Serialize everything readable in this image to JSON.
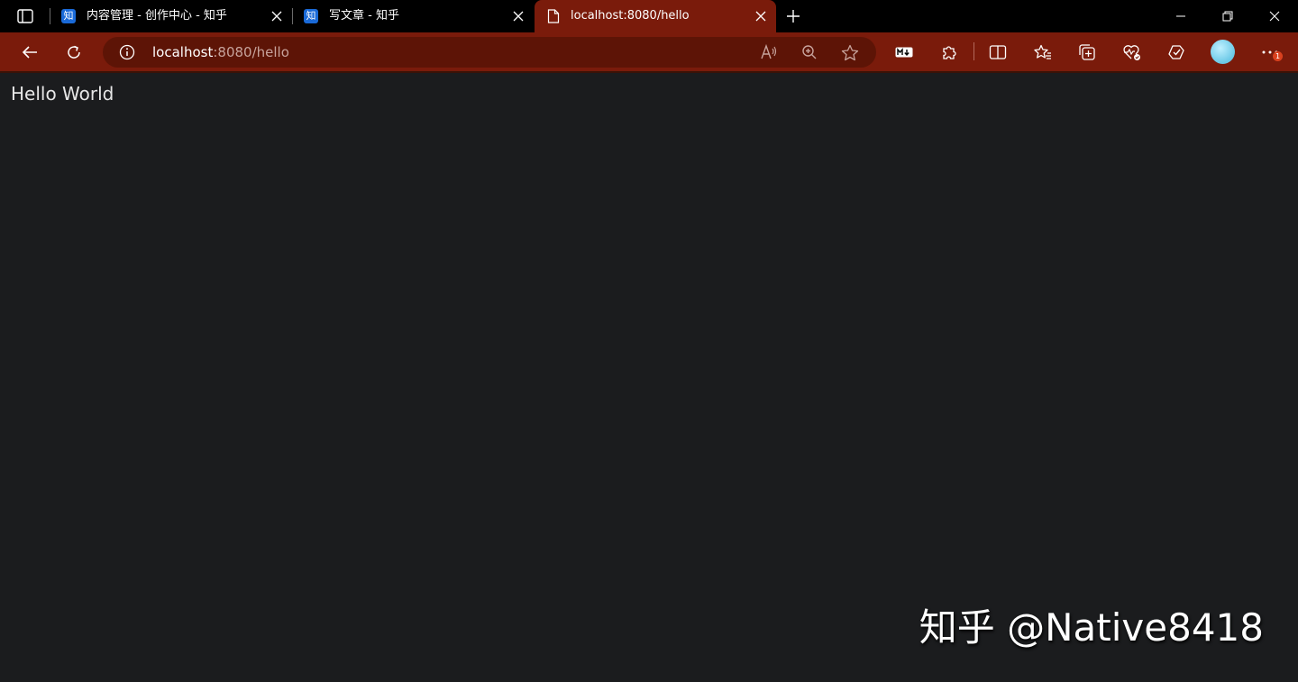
{
  "tabs": [
    {
      "title": "内容管理 - 创作中心 - 知乎",
      "favicon": "zhihu-icon",
      "favicon_text": "知",
      "active": false
    },
    {
      "title": "写文章 - 知乎",
      "favicon": "zhihu-icon",
      "favicon_text": "知",
      "active": false
    },
    {
      "title": "localhost:8080/hello",
      "favicon": "document-icon",
      "active": true
    }
  ],
  "address": {
    "host": "localhost",
    "path": ":8080/hello"
  },
  "page": {
    "heading": "Hello World"
  },
  "watermark": "知乎 @Native8418",
  "notification_count": "1",
  "colors": {
    "accent": "#7a1b0b",
    "address_bg": "#5d1406",
    "page_bg": "#1b1c1e",
    "zhihu_blue": "#1a6ad8"
  }
}
